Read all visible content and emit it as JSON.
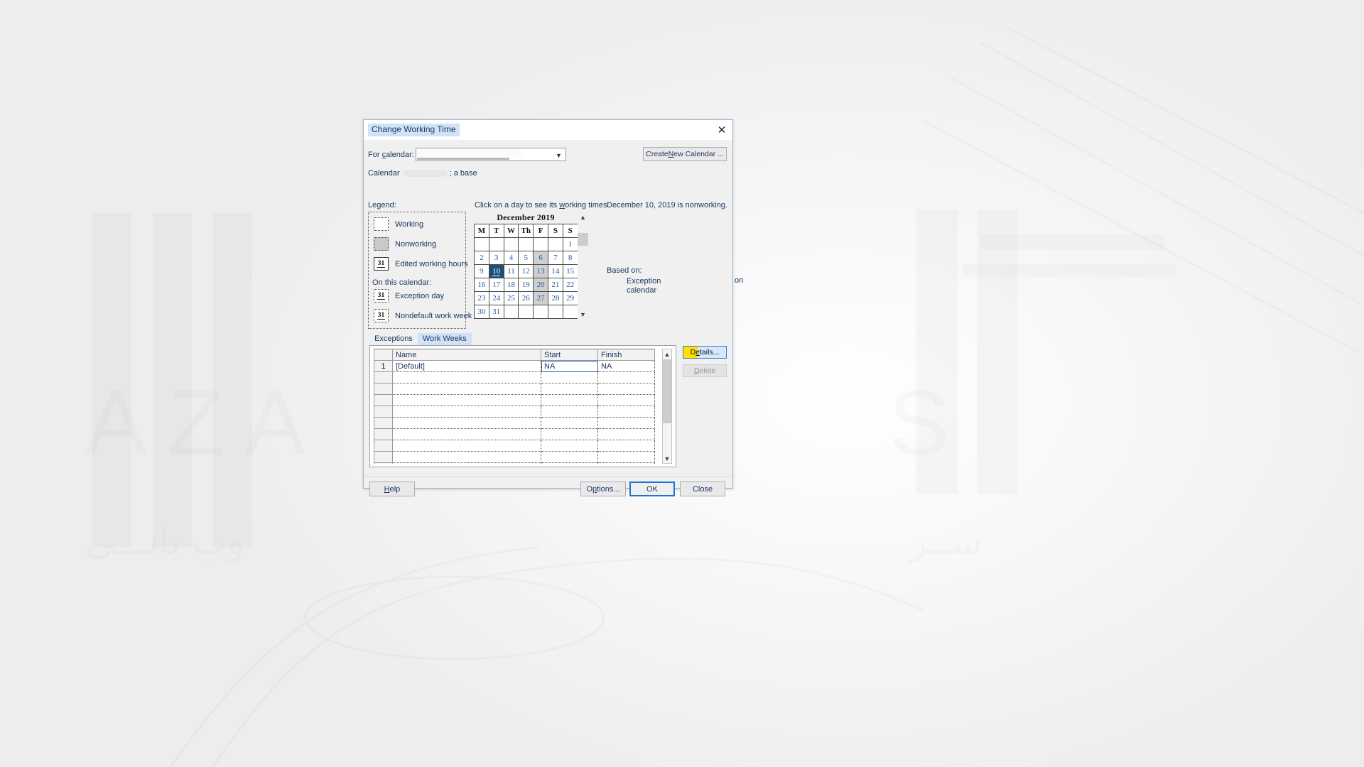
{
  "window": {
    "title": "Change Working Time",
    "close_icon": "close-icon"
  },
  "calendar_selector": {
    "for_calendar_label": "For calendar:",
    "for_calendar_value": "",
    "dropdown_icon": "chevron-down-icon",
    "create_new_calendar_label": "Create New Calendar ...",
    "calendar_base_prefix": "Calendar",
    "calendar_base_suffix": "; a base"
  },
  "legend": {
    "caption": "Legend:",
    "items": [
      {
        "label": "Working",
        "swatch": "working-swatch"
      },
      {
        "label": "Nonworking",
        "swatch": "nonworking-swatch"
      },
      {
        "label": "Edited working hours",
        "swatch": "edited-hours-swatch",
        "glyph": "31"
      }
    ],
    "on_this_calendar_caption": "On this calendar:",
    "calendar_items": [
      {
        "label": "Exception day",
        "swatch": "exception-day-swatch",
        "glyph": "31"
      },
      {
        "label": "Nondefault work week",
        "swatch": "nondefault-week-swatch",
        "glyph": "31"
      }
    ]
  },
  "calendar_panel": {
    "hint": "Click on a day to see its working times:",
    "status_message": "December 10, 2019 is nonworking.",
    "month_title": "December 2019",
    "weekday_headers": [
      "M",
      "T",
      "W",
      "Th",
      "F",
      "S",
      "S"
    ],
    "weeks": [
      [
        {
          "d": "",
          "t": "empty"
        },
        {
          "d": "",
          "t": "empty"
        },
        {
          "d": "",
          "t": "empty"
        },
        {
          "d": "",
          "t": "empty"
        },
        {
          "d": "",
          "t": "empty"
        },
        {
          "d": "",
          "t": "empty"
        },
        {
          "d": "1",
          "t": "work"
        }
      ],
      [
        {
          "d": "2",
          "t": "work"
        },
        {
          "d": "3",
          "t": "work"
        },
        {
          "d": "4",
          "t": "work"
        },
        {
          "d": "5",
          "t": "work"
        },
        {
          "d": "6",
          "t": "nonworking"
        },
        {
          "d": "7",
          "t": "work"
        },
        {
          "d": "8",
          "t": "work"
        }
      ],
      [
        {
          "d": "9",
          "t": "work"
        },
        {
          "d": "10",
          "t": "selected"
        },
        {
          "d": "11",
          "t": "work"
        },
        {
          "d": "12",
          "t": "work"
        },
        {
          "d": "13",
          "t": "nonworking"
        },
        {
          "d": "14",
          "t": "work"
        },
        {
          "d": "15",
          "t": "work"
        }
      ],
      [
        {
          "d": "16",
          "t": "work"
        },
        {
          "d": "17",
          "t": "work"
        },
        {
          "d": "18",
          "t": "work"
        },
        {
          "d": "19",
          "t": "work"
        },
        {
          "d": "20",
          "t": "nonworking"
        },
        {
          "d": "21",
          "t": "work"
        },
        {
          "d": "22",
          "t": "work"
        }
      ],
      [
        {
          "d": "23",
          "t": "work"
        },
        {
          "d": "24",
          "t": "work"
        },
        {
          "d": "25",
          "t": "work"
        },
        {
          "d": "26",
          "t": "work"
        },
        {
          "d": "27",
          "t": "nonworking"
        },
        {
          "d": "28",
          "t": "work"
        },
        {
          "d": "29",
          "t": "work"
        }
      ],
      [
        {
          "d": "30",
          "t": "work"
        },
        {
          "d": "31",
          "t": "work"
        },
        {
          "d": "",
          "t": "empty"
        },
        {
          "d": "",
          "t": "empty"
        },
        {
          "d": "",
          "t": "empty"
        },
        {
          "d": "",
          "t": "empty"
        },
        {
          "d": "",
          "t": "empty"
        }
      ]
    ],
    "scroll_up_icon": "chevron-up-icon",
    "scroll_down_icon": "chevron-down-icon",
    "selected_day": "10"
  },
  "based_on": {
    "caption": "Based on:",
    "line1": "Exception",
    "line2": "calendar",
    "trailing": "on"
  },
  "tabs": [
    {
      "label": "Exceptions",
      "active": false
    },
    {
      "label": "Work Weeks",
      "active": true
    }
  ],
  "grid": {
    "headers": [
      "",
      "Name",
      "Start",
      "Finish"
    ],
    "rows": [
      {
        "index": "1",
        "name": "[Default]",
        "start": "NA",
        "finish": "NA"
      },
      {
        "index": "",
        "name": "",
        "start": "",
        "finish": ""
      },
      {
        "index": "",
        "name": "",
        "start": "",
        "finish": ""
      },
      {
        "index": "",
        "name": "",
        "start": "",
        "finish": ""
      },
      {
        "index": "",
        "name": "",
        "start": "",
        "finish": ""
      },
      {
        "index": "",
        "name": "",
        "start": "",
        "finish": ""
      },
      {
        "index": "",
        "name": "",
        "start": "",
        "finish": ""
      },
      {
        "index": "",
        "name": "",
        "start": "",
        "finish": ""
      },
      {
        "index": "",
        "name": "",
        "start": "",
        "finish": ""
      },
      {
        "index": "",
        "name": "",
        "start": "",
        "finish": ""
      }
    ],
    "scroll_up_icon": "chevron-up-icon",
    "scroll_down_icon": "chevron-down-icon"
  },
  "side_buttons": {
    "details_label": "Details...",
    "delete_label": "Delete",
    "details_highlight_color": "#ffe000",
    "details_focus_color": "#d6e8fb"
  },
  "footer": {
    "help_label": "Help",
    "options_label": "Options...",
    "ok_label": "OK",
    "close_label": "Close"
  },
  "theme": {
    "accent": "#1f3864",
    "title_highlight": "#cfe2f7",
    "selected_day": "#1f4e79",
    "nonworking": "#cfcfcf",
    "default_button_border": "#1f76d2"
  }
}
